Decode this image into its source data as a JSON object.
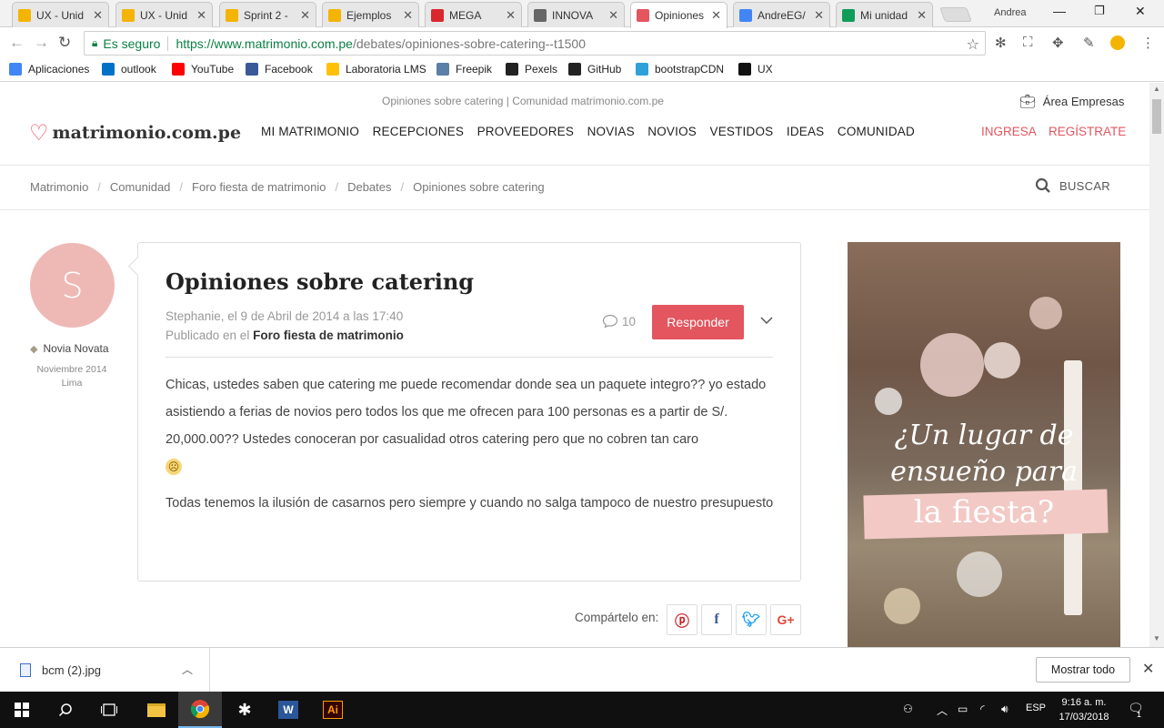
{
  "browser": {
    "tabs": [
      {
        "title": "UX - Unid",
        "icon": "slides-icon",
        "color": "#f4b400"
      },
      {
        "title": "UX - Unid",
        "icon": "slides-icon",
        "color": "#f4b400"
      },
      {
        "title": "Sprint 2 -",
        "icon": "slides-icon",
        "color": "#f4b400"
      },
      {
        "title": "Ejemplos",
        "icon": "slides-icon",
        "color": "#f4b400"
      },
      {
        "title": "MEGA",
        "icon": "mega-icon",
        "color": "#d9272e"
      },
      {
        "title": "INNOVA",
        "icon": "page-icon",
        "color": "#666666"
      },
      {
        "title": "Opiniones",
        "icon": "heart-icon",
        "color": "#e3555f"
      },
      {
        "title": "AndreEG/",
        "icon": "loading-icon",
        "color": "#4285f4"
      },
      {
        "title": "Mi unidad",
        "icon": "drive-icon",
        "color": "#0f9d58"
      }
    ],
    "user": "Andrea",
    "secure_label": "Es seguro",
    "url_host": "https://www.matrimonio.com.pe",
    "url_path": "/debates/opiniones-sobre-catering--t1500",
    "bookmarks": [
      {
        "label": "Aplicaciones",
        "icon": "apps-icon",
        "color": "#4285f4"
      },
      {
        "label": "outlook",
        "icon": "outlook-icon",
        "color": "#0072c6"
      },
      {
        "label": "YouTube",
        "icon": "youtube-icon",
        "color": "#ff0000"
      },
      {
        "label": "Facebook",
        "icon": "facebook-icon",
        "color": "#3b5998"
      },
      {
        "label": "Laboratoria LMS",
        "icon": "laboratoria-icon",
        "color": "#ffc107"
      },
      {
        "label": "Freepik",
        "icon": "freepik-icon",
        "color": "#5a7fa8"
      },
      {
        "label": "Pexels",
        "icon": "pexels-icon",
        "color": "#222222"
      },
      {
        "label": "GitHub",
        "icon": "github-icon",
        "color": "#222222"
      },
      {
        "label": "bootstrapCDN",
        "icon": "bootstrap-icon",
        "color": "#2ea1d9"
      },
      {
        "label": "UX",
        "icon": "medium-icon",
        "color": "#111111"
      }
    ]
  },
  "site": {
    "top_info": "Opiniones sobre catering | Comunidad matrimonio.com.pe",
    "business_area": "Área Empresas",
    "logo_text": "matrimonio.com.pe",
    "nav": [
      "MI MATRIMONIO",
      "RECEPCIONES",
      "PROVEEDORES",
      "NOVIAS",
      "NOVIOS",
      "VESTIDOS",
      "IDEAS",
      "COMUNIDAD"
    ],
    "login": "INGRESA",
    "register": "REGÍSTRATE",
    "breadcrumb": [
      "Matrimonio",
      "Comunidad",
      "Foro fiesta de matrimonio",
      "Debates",
      "Opiniones sobre catering"
    ],
    "search_label": "BUSCAR",
    "accent": "#e3555f"
  },
  "author": {
    "initial": "S",
    "rank": "Novia Novata",
    "since": "Noviembre 2014",
    "city": "Lima"
  },
  "post": {
    "title": "Opiniones sobre catering",
    "meta_line": "Stephanie, el 9 de Abril de 2014 a las 17:40",
    "published_prefix": "Publicado en el",
    "forum": "Foro fiesta de matrimonio",
    "comment_count": "10",
    "reply_label": "Responder",
    "paragraph1": "Chicas, ustedes saben que catering me puede recomendar donde sea un paquete integro?? yo estado asistiendo a ferias de novios pero todos los que me ofrecen para 100 personas es a partir de S/. 20,000.00?? Ustedes conoceran por casualidad otros catering pero que no cobren tan caro",
    "paragraph2": "Todas tenemos la ilusión de casarnos pero siempre y cuando no salga tampoco de nuestro presupuesto"
  },
  "share": {
    "label": "Compártelo en:",
    "networks": [
      "pinterest",
      "facebook",
      "twitter",
      "google-plus"
    ]
  },
  "ad": {
    "line1": "¿Un lugar de",
    "line2": "ensueño para",
    "line3": "la fiesta?"
  },
  "downloads": {
    "file": "bcm (2).jpg",
    "show_all": "Mostrar todo"
  },
  "taskbar": {
    "language": "ESP",
    "time": "9:16 a. m.",
    "date": "17/03/2018",
    "notifications": "1"
  }
}
